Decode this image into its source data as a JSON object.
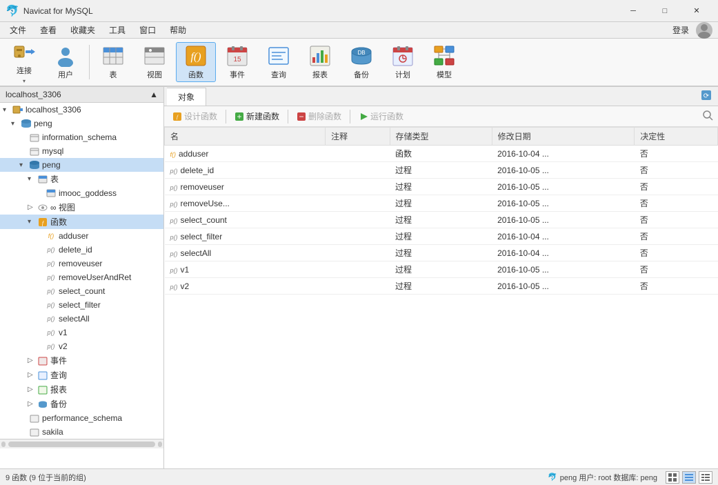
{
  "app": {
    "title": "Navicat for MySQL",
    "icon": "🐬"
  },
  "titlebar": {
    "minimize_label": "─",
    "maximize_label": "□",
    "close_label": "✕"
  },
  "menu": {
    "items": [
      "文件",
      "查看",
      "收藏夹",
      "工具",
      "窗口",
      "帮助"
    ]
  },
  "toolbar": {
    "buttons": [
      {
        "id": "connect",
        "label": "连接",
        "icon": "connect"
      },
      {
        "id": "user",
        "label": "用户",
        "icon": "user"
      },
      {
        "id": "table",
        "label": "表",
        "icon": "table"
      },
      {
        "id": "view",
        "label": "视图",
        "icon": "view"
      },
      {
        "id": "function",
        "label": "函数",
        "icon": "function",
        "active": true
      },
      {
        "id": "event",
        "label": "事件",
        "icon": "event"
      },
      {
        "id": "query",
        "label": "查询",
        "icon": "query"
      },
      {
        "id": "report",
        "label": "报表",
        "icon": "report"
      },
      {
        "id": "backup",
        "label": "备份",
        "icon": "backup"
      },
      {
        "id": "plan",
        "label": "计划",
        "icon": "plan"
      },
      {
        "id": "model",
        "label": "模型",
        "icon": "model"
      }
    ],
    "login_label": "登录"
  },
  "sidebar": {
    "connection": "localhost_3306",
    "tree": [
      {
        "id": "localhost",
        "label": "localhost_3306",
        "level": 0,
        "type": "connection",
        "expanded": true
      },
      {
        "id": "peng_db",
        "label": "peng",
        "level": 1,
        "type": "database",
        "expanded": true,
        "selected": false
      },
      {
        "id": "information_schema",
        "label": "information_schema",
        "level": 2,
        "type": "table-group"
      },
      {
        "id": "mysql",
        "label": "mysql",
        "level": 2,
        "type": "table-group"
      },
      {
        "id": "peng",
        "label": "peng",
        "level": 2,
        "type": "database-open",
        "expanded": true
      },
      {
        "id": "tables",
        "label": "表",
        "level": 3,
        "type": "table-group",
        "expanded": true
      },
      {
        "id": "imooc_goddess",
        "label": "imooc_goddess",
        "level": 4,
        "type": "table"
      },
      {
        "id": "views",
        "label": "视图",
        "level": 3,
        "type": "view-group"
      },
      {
        "id": "functions",
        "label": "函数",
        "level": 3,
        "type": "func-group",
        "expanded": true,
        "selected": true
      },
      {
        "id": "adduser",
        "label": "adduser",
        "level": 4,
        "type": "func"
      },
      {
        "id": "delete_id",
        "label": "delete_id",
        "level": 4,
        "type": "proc"
      },
      {
        "id": "removeuser",
        "label": "removeuser",
        "level": 4,
        "type": "proc"
      },
      {
        "id": "removeUserAndRet",
        "label": "removeUserAndRet",
        "level": 4,
        "type": "proc"
      },
      {
        "id": "select_count",
        "label": "select_count",
        "level": 4,
        "type": "proc"
      },
      {
        "id": "select_filter",
        "label": "select_filter",
        "level": 4,
        "type": "proc"
      },
      {
        "id": "selectAll",
        "label": "selectAll",
        "level": 4,
        "type": "proc"
      },
      {
        "id": "v1",
        "label": "v1",
        "level": 4,
        "type": "proc"
      },
      {
        "id": "v2",
        "label": "v2",
        "level": 4,
        "type": "proc"
      },
      {
        "id": "events",
        "label": "事件",
        "level": 3,
        "type": "event-group"
      },
      {
        "id": "queries",
        "label": "查询",
        "level": 3,
        "type": "query-group"
      },
      {
        "id": "reports",
        "label": "报表",
        "level": 3,
        "type": "report-group"
      },
      {
        "id": "backup_group",
        "label": "备份",
        "level": 3,
        "type": "backup-group"
      },
      {
        "id": "performance_schema",
        "label": "performance_schema",
        "level": 2,
        "type": "table-group"
      },
      {
        "id": "sakila",
        "label": "sakila",
        "level": 2,
        "type": "table-group"
      }
    ]
  },
  "content": {
    "tab_label": "对象",
    "toolbar": {
      "design_label": "设计函数",
      "new_label": "新建函数",
      "delete_label": "删除函数",
      "run_label": "运行函数"
    },
    "table": {
      "columns": [
        "名",
        "注释",
        "存储类型",
        "修改日期",
        "决定性"
      ],
      "rows": [
        {
          "name": "adduser",
          "comment": "",
          "type": "函数",
          "modified": "2016-10-04 ...",
          "deterministic": "否"
        },
        {
          "name": "delete_id",
          "comment": "",
          "type": "过程",
          "modified": "2016-10-05 ...",
          "deterministic": "否"
        },
        {
          "name": "removeuser",
          "comment": "",
          "type": "过程",
          "modified": "2016-10-05 ...",
          "deterministic": "否"
        },
        {
          "name": "removeUse...",
          "comment": "",
          "type": "过程",
          "modified": "2016-10-05 ...",
          "deterministic": "否"
        },
        {
          "name": "select_count",
          "comment": "",
          "type": "过程",
          "modified": "2016-10-05 ...",
          "deterministic": "否"
        },
        {
          "name": "select_filter",
          "comment": "",
          "type": "过程",
          "modified": "2016-10-04 ...",
          "deterministic": "否"
        },
        {
          "name": "selectAll",
          "comment": "",
          "type": "过程",
          "modified": "2016-10-04 ...",
          "deterministic": "否"
        },
        {
          "name": "v1",
          "comment": "",
          "type": "过程",
          "modified": "2016-10-05 ...",
          "deterministic": "否"
        },
        {
          "name": "v2",
          "comment": "",
          "type": "过程",
          "modified": "2016-10-05 ...",
          "deterministic": "否"
        }
      ]
    }
  },
  "statusbar": {
    "count_text": "9 函数 (9 位于当前的组)",
    "connection_info": "peng  用户: root  数据库: peng",
    "connection_icon": "🐬"
  }
}
